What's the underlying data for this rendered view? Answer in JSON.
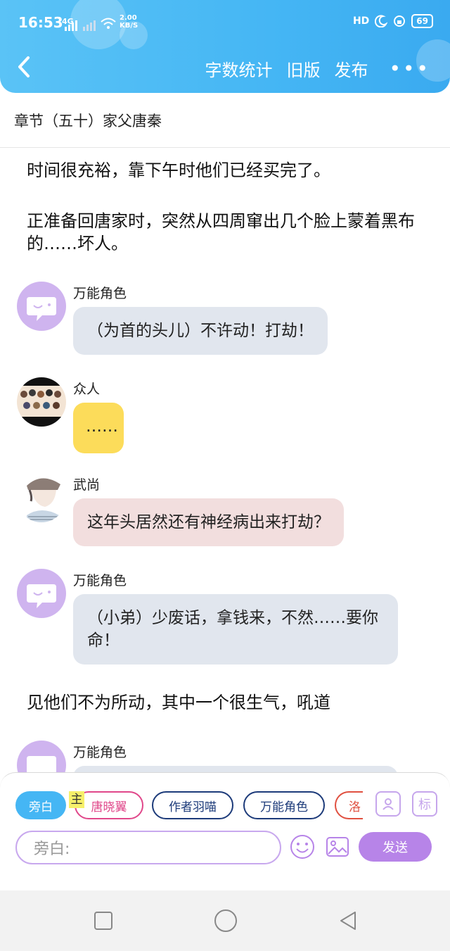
{
  "status_bar": {
    "time": "16:53",
    "signal_1": "4G",
    "net_speed_value": "2.00",
    "net_speed_unit": "KB/S",
    "hd_label": "HD",
    "battery": "69"
  },
  "header": {
    "actions": [
      "字数统计",
      "旧版",
      "发布"
    ],
    "more_label": "•••"
  },
  "chapter": {
    "title": "章节（五十）家父唐秦"
  },
  "content": {
    "narration_1": "时间很充裕，靠下午时他们已经买完了。",
    "narration_2": "正准备回唐家时，突然从四周窜出几个脸上蒙着黑布的……坏人。",
    "messages": [
      {
        "name": "万能角色",
        "text": "（为首的头儿）不许动！打劫！"
      },
      {
        "name": "众人",
        "text": "……"
      },
      {
        "name": "武尚",
        "text": "这年头居然还有神经病出来打劫？"
      },
      {
        "name": "万能角色",
        "text": "（小弟）少废话，拿钱来，不然……要你命！"
      },
      {
        "name": "万能角色",
        "text": ""
      }
    ],
    "narration_3": "见他们不为所动，其中一个很生气，吼道"
  },
  "bottom_panel": {
    "roles": [
      "旁白",
      "唐晓翼",
      "作者羽喵",
      "万能角色",
      "洛"
    ],
    "main_tag": "主",
    "tag_button": "标",
    "input_placeholder": "旁白:",
    "send_label": "发送"
  },
  "colors": {
    "header_blue": "#45b6f4",
    "accent_purple": "#b784e8",
    "bubble_gray": "#e1e6ee",
    "bubble_yellow": "#fcdc5a",
    "bubble_pink": "#f2dede"
  },
  "icons": [
    "back-arrow-icon",
    "more-icon",
    "emoji-icon",
    "image-icon",
    "role-avatar-icon",
    "square-nav-icon",
    "circle-nav-icon",
    "triangle-back-icon"
  ]
}
